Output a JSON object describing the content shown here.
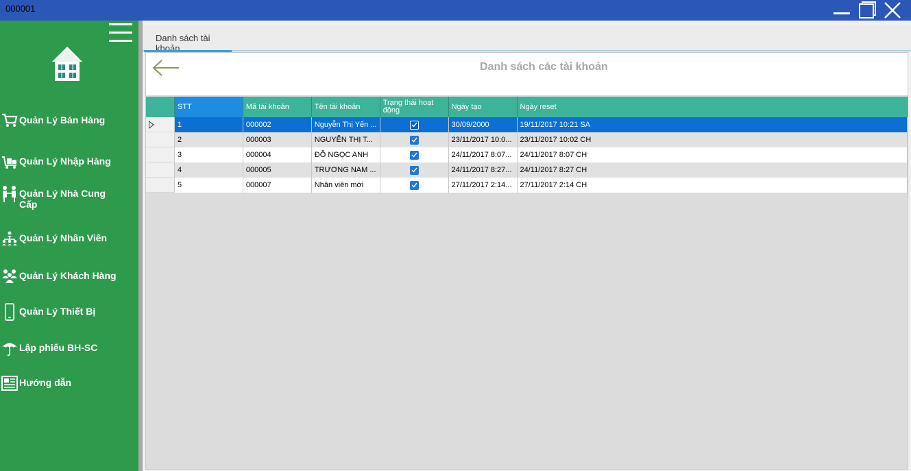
{
  "window": {
    "title": "000001"
  },
  "sidebar": {
    "items": [
      {
        "label": "Quản Lý Bán Hàng",
        "icon": "shopping-cart-icon"
      },
      {
        "label": "Quản Lý Nhập Hàng",
        "icon": "delivery-cart-icon"
      },
      {
        "label": "Quản Lý Nhà Cung Cấp",
        "icon": "supplier-handshake-icon"
      },
      {
        "label": "Quản Lý Nhân Viên",
        "icon": "employee-hierarchy-icon"
      },
      {
        "label": "Quản Lý Khách Hàng",
        "icon": "customers-group-icon"
      },
      {
        "label": "Quản Lý Thiết Bị",
        "icon": "mobile-phone-icon"
      },
      {
        "label": "Lập phiếu BH-SC",
        "icon": "umbrella-icon"
      },
      {
        "label": "Hướng dẫn",
        "icon": "newspaper-icon"
      }
    ]
  },
  "tabs": [
    {
      "label": "Danh sách tài khoản",
      "active": true
    }
  ],
  "main": {
    "title": "Danh sách các tài khoản"
  },
  "table": {
    "columns": [
      "STT",
      "Mã tài khoản",
      "Tên tài khoản",
      "Trạng thái hoạt động",
      "Ngày tạo",
      "Ngày reset"
    ],
    "rows": [
      {
        "stt": "1",
        "ma": "000002",
        "ten": "Nguyễn Thị Yến ...",
        "active": true,
        "ngay_tao": "30/09/2000",
        "ngay_reset": "19/11/2017 10:21 SA"
      },
      {
        "stt": "2",
        "ma": "000003",
        "ten": "NGUYỄN THỊ T...",
        "active": true,
        "ngay_tao": "23/11/2017 10:0...",
        "ngay_reset": "23/11/2017 10:02 CH"
      },
      {
        "stt": "3",
        "ma": "000004",
        "ten": "ĐỖ NGỌC ANH",
        "active": true,
        "ngay_tao": "24/11/2017 8:07...",
        "ngay_reset": "24/11/2017 8:07 CH"
      },
      {
        "stt": "4",
        "ma": "000005",
        "ten": "TRƯƠNG NAM ...",
        "active": true,
        "ngay_tao": "24/11/2017 8:27...",
        "ngay_reset": "24/11/2017 8:27 CH"
      },
      {
        "stt": "5",
        "ma": "000007",
        "ten": "Nhân viên mới",
        "active": true,
        "ngay_tao": "27/11/2017 2:14...",
        "ngay_reset": "27/11/2017 2:14 CH"
      }
    ],
    "selected_row": 0
  },
  "colors": {
    "titlebar": "#2b58b8",
    "sidebar": "#2e9a4c",
    "grid_header": "#3db39a",
    "selection": "#0b6fd4",
    "tab_accent": "#35a4de"
  }
}
